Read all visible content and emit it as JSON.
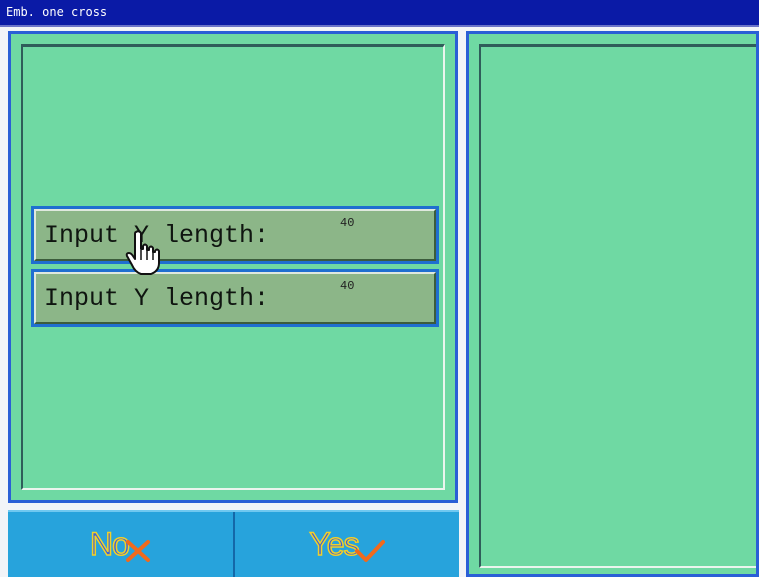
{
  "window": {
    "title": "Emb. one cross"
  },
  "fields": [
    {
      "label": "Input Y length:",
      "value": "40"
    },
    {
      "label": "Input Y length:",
      "value": "40"
    }
  ],
  "buttons": {
    "no_label": "No",
    "yes_label": "Yes"
  },
  "colors": {
    "titlebar": "#0a1aa6",
    "panel": "#6fd9a3",
    "row": "#8cb688",
    "buttonbar": "#27a3dc",
    "accent_border": "#2a5fd6"
  },
  "icons": {
    "no": "cross-icon",
    "yes": "checkmark-icon",
    "pointer": "hand-pointer-icon"
  }
}
